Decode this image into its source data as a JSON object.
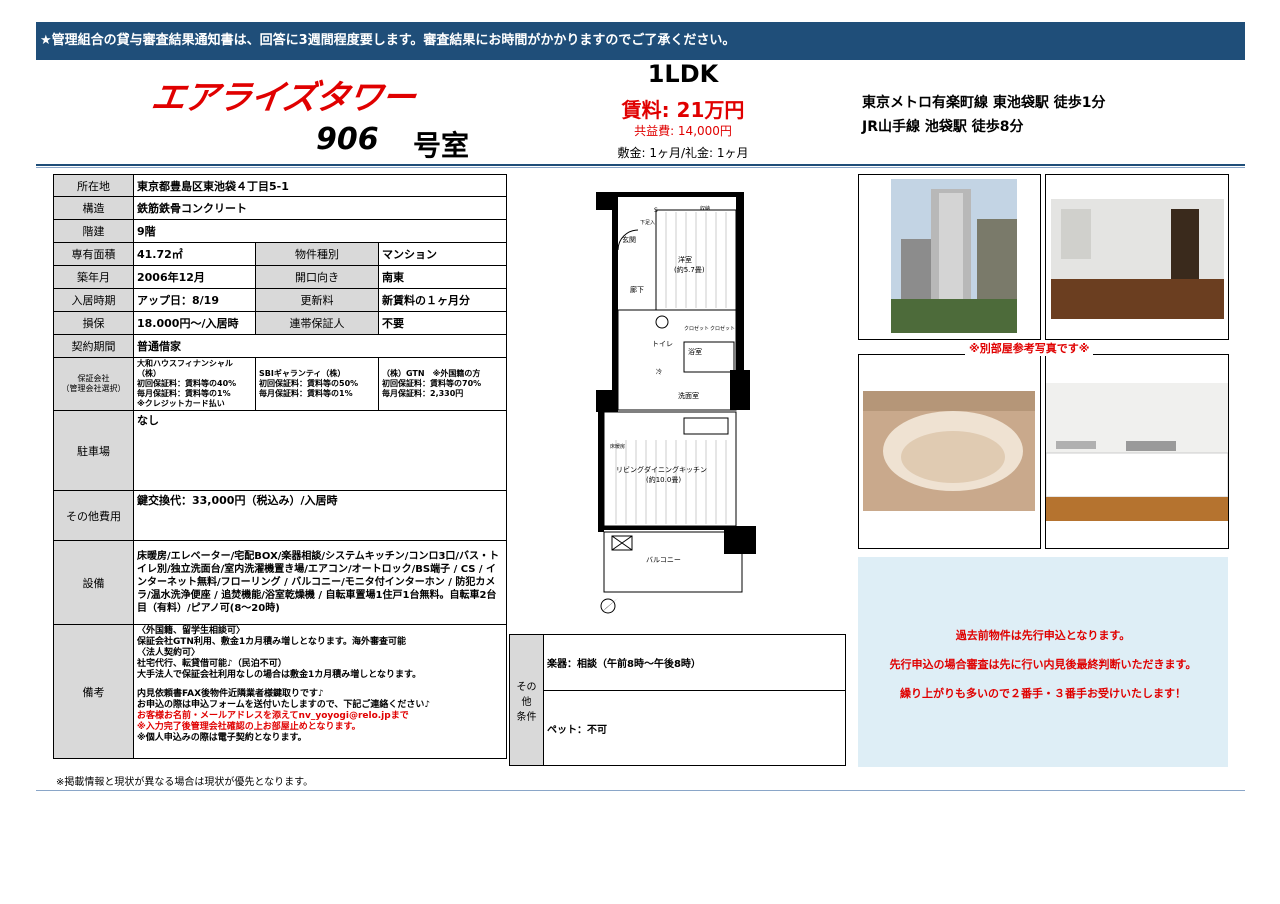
{
  "banner": {
    "text": "★管理組合の貸与審査結果通知書は、回答に3週間程度要します。審査結果にお時間がかかりますのでご了承ください。"
  },
  "header": {
    "building_name": "エアライズタワー",
    "room_number": "906",
    "room_unit": "号室",
    "layout": "1LDK",
    "rent": "賃料: 21万円",
    "common_fee": "共益費: 14,000円",
    "deposit": "敷金: 1ヶ月/礼金: 1ヶ月",
    "access": [
      "東京メトロ有楽町線 東池袋駅 徒歩1分",
      "JR山手線 池袋駅 徒歩8分"
    ]
  },
  "info": {
    "address_label": "所在地",
    "address": "東京都豊島区東池袋４丁目5-1",
    "structure_label": "構造",
    "structure": "鉄筋鉄骨コンクリート",
    "floor_label": "階建",
    "floor": "9階",
    "area_label": "専有面積",
    "area": "41.72㎡",
    "type_label": "物件種別",
    "type": "マンション",
    "built_label": "築年月",
    "built": "2006年12月",
    "direction_label": "開口向き",
    "direction": "南東",
    "movein_label": "入居時期",
    "movein": "アップ日：8/19",
    "renewal_label": "更新料",
    "renewal": "新賃料の１ヶ月分",
    "insurance_label": "損保",
    "insurance": "18.000円～/入居時",
    "guarantor_label": "連帯保証人",
    "guarantor": "不要",
    "contract_label": "契約期間",
    "contract": "普通借家",
    "guarantee_label_1": "保証会社",
    "guarantee_label_2": "（管理会社選択）",
    "guarantee_1": [
      "大和ハウスフィナンシャル（株）",
      "初回保証料：賃料等の40%",
      "毎月保証料：賃料等の1%",
      "※クレジットカード払い"
    ],
    "guarantee_2": [
      "SBIギャランティ（株）",
      "初回保証料：賃料等の50%",
      "毎月保証料：賃料等の1%"
    ],
    "guarantee_3": [
      "（株）GTN　※外国籍の方",
      "初回保証料：賃料等の70%",
      "毎月保証料：2,330円"
    ],
    "parking_label": "駐車場",
    "parking": "なし",
    "other_cost_label": "その他費用",
    "other_cost": "鍵交換代：33,000円（税込み）/入居時",
    "equipment_label": "設備",
    "equipment": "床暖房/エレベーター/宅配BOX/楽器相談/システムキッチン/コンロ3口/バス・トイレ別/独立洗面台/室内洗濯機置き場/エアコン/オートロック/BS端子 / CS / インターネット無料/フローリング / バルコニー/モニタ付インターホン / 防犯カメラ/温水洗浄便座 / 追焚機能/浴室乾燥機 / 自転車置場1住戸1台無料。自転車2台目（有料）/ピアノ可(8～20時)",
    "remarks_label": "備考",
    "remarks": [
      "〈外国籍、留学生相談可〉",
      "保証会社GTN利用、敷金1カ月積み増しとなります。海外審査可能",
      "〈法人契約可〉",
      "社宅代行、転貸借可能♪（民泊不可）",
      "大手法人で保証会社利用なしの場合は敷金1カ月積み増しとなります。",
      "",
      "内見依頼書FAX後物件近隣業者様鍵取りです♪",
      "お申込の際は申込フォームを送付いたしますので、下記ご連絡ください♪"
    ],
    "remarks_red": [
      "お客様お名前・メールアドレスを添えてnv_yoyogi@relo.jpまで",
      "※入力完了後管理会社確認の上お部屋止めとなります。"
    ],
    "remarks_last": "※個人申込みの際は電子契約となります。",
    "other_cond_label_1": "その他",
    "other_cond_label_2": "条件",
    "instrument": "楽器：相談（午前8時～午後8時）",
    "pet": "ペット：不可"
  },
  "floorplan": {
    "rooms": [
      "洋室",
      "(約5.7畳)",
      "玄関",
      "廊下",
      "トイレ",
      "浴室",
      "洗面室",
      "リビングダイニングキッチン",
      "(約10.0畳)",
      "バルコニー",
      "クロゼット",
      "クロゼット",
      "収納",
      "下足入",
      "床暖房",
      "冷",
      "洗",
      "S"
    ]
  },
  "photos": {
    "ref_note": "※別部屋参考写真です※"
  },
  "promo": {
    "lines": [
      "過去前物件は先行申込となります。",
      "先行申込の場合審査は先に行い内見後最終判断いただきます。",
      "繰り上がりも多いので２番手・３番手お受けいたします！"
    ]
  },
  "footnote": "※掲載情報と現状が異なる場合は現状が優先となります。",
  "colors": {
    "banner": "#1f4e79",
    "accent_red": "#e00000",
    "label_bg": "#d9d9d9",
    "promo_bg": "#deeef6"
  }
}
